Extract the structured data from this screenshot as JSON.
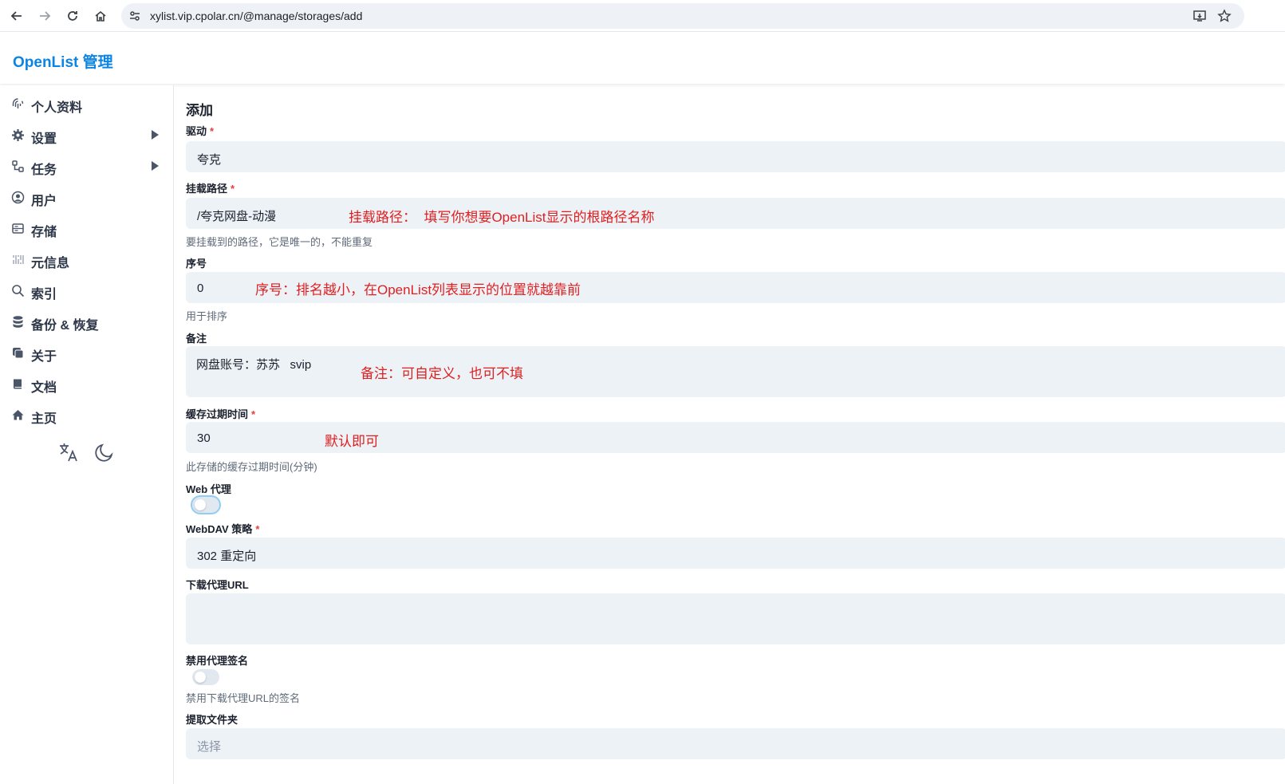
{
  "browser": {
    "url": "xylist.vip.cpolar.cn/@manage/storages/add"
  },
  "app": {
    "brand": "OpenList 管理"
  },
  "sidebar": {
    "items": [
      {
        "label": "个人资料",
        "icon": "fingerprint-icon",
        "expandable": false
      },
      {
        "label": "设置",
        "icon": "gear-icon",
        "expandable": true
      },
      {
        "label": "任务",
        "icon": "tasks-icon",
        "expandable": true
      },
      {
        "label": "用户",
        "icon": "user-icon",
        "expandable": false
      },
      {
        "label": "存储",
        "icon": "storage-icon",
        "expandable": false
      },
      {
        "label": "元信息",
        "icon": "meta-icon",
        "expandable": false
      },
      {
        "label": "索引",
        "icon": "search-icon",
        "expandable": false
      },
      {
        "label": "备份 & 恢复",
        "icon": "database-icon",
        "expandable": false
      },
      {
        "label": "关于",
        "icon": "about-icon",
        "expandable": false
      },
      {
        "label": "文档",
        "icon": "book-icon",
        "expandable": false
      },
      {
        "label": "主页",
        "icon": "home-icon",
        "expandable": false
      }
    ]
  },
  "form": {
    "title": "添加",
    "driver": {
      "label": "驱动",
      "required": "*",
      "value": "夸克"
    },
    "mount_path": {
      "label": "挂载路径",
      "required": "*",
      "value": "/夸克网盘-动漫",
      "help": "要挂载到的路径，它是唯一的，不能重复"
    },
    "order": {
      "label": "序号",
      "value": "0",
      "help": "用于排序"
    },
    "remark": {
      "label": "备注",
      "value": "网盘账号：苏苏   svip"
    },
    "cache_expiration": {
      "label": "缓存过期时间",
      "required": "*",
      "value": "30",
      "help": "此存储的缓存过期时间(分钟)"
    },
    "web_proxy": {
      "label": "Web 代理",
      "enabled": false
    },
    "webdav_policy": {
      "label": "WebDAV 策略",
      "required": "*",
      "value": "302 重定向"
    },
    "down_proxy_url": {
      "label": "下载代理URL",
      "value": ""
    },
    "disable_proxy_sign": {
      "label": "禁用代理签名",
      "enabled": false,
      "help": "禁用下载代理URL的签名"
    },
    "extract_folder": {
      "label": "提取文件夹",
      "placeholder": "选择"
    }
  },
  "annotations": {
    "mount_path": "挂载路径：  填写你想要OpenList显示的根路径名称",
    "order": "序号：排名越小，在OpenList列表显示的位置就越靠前",
    "remark": "备注：可自定义，也可不填",
    "cache": "默认即可"
  },
  "colors": {
    "brand": "#0b84e3",
    "annotation": "#e02020",
    "input_bg": "#edf2f7",
    "required": "#e53e3e"
  }
}
